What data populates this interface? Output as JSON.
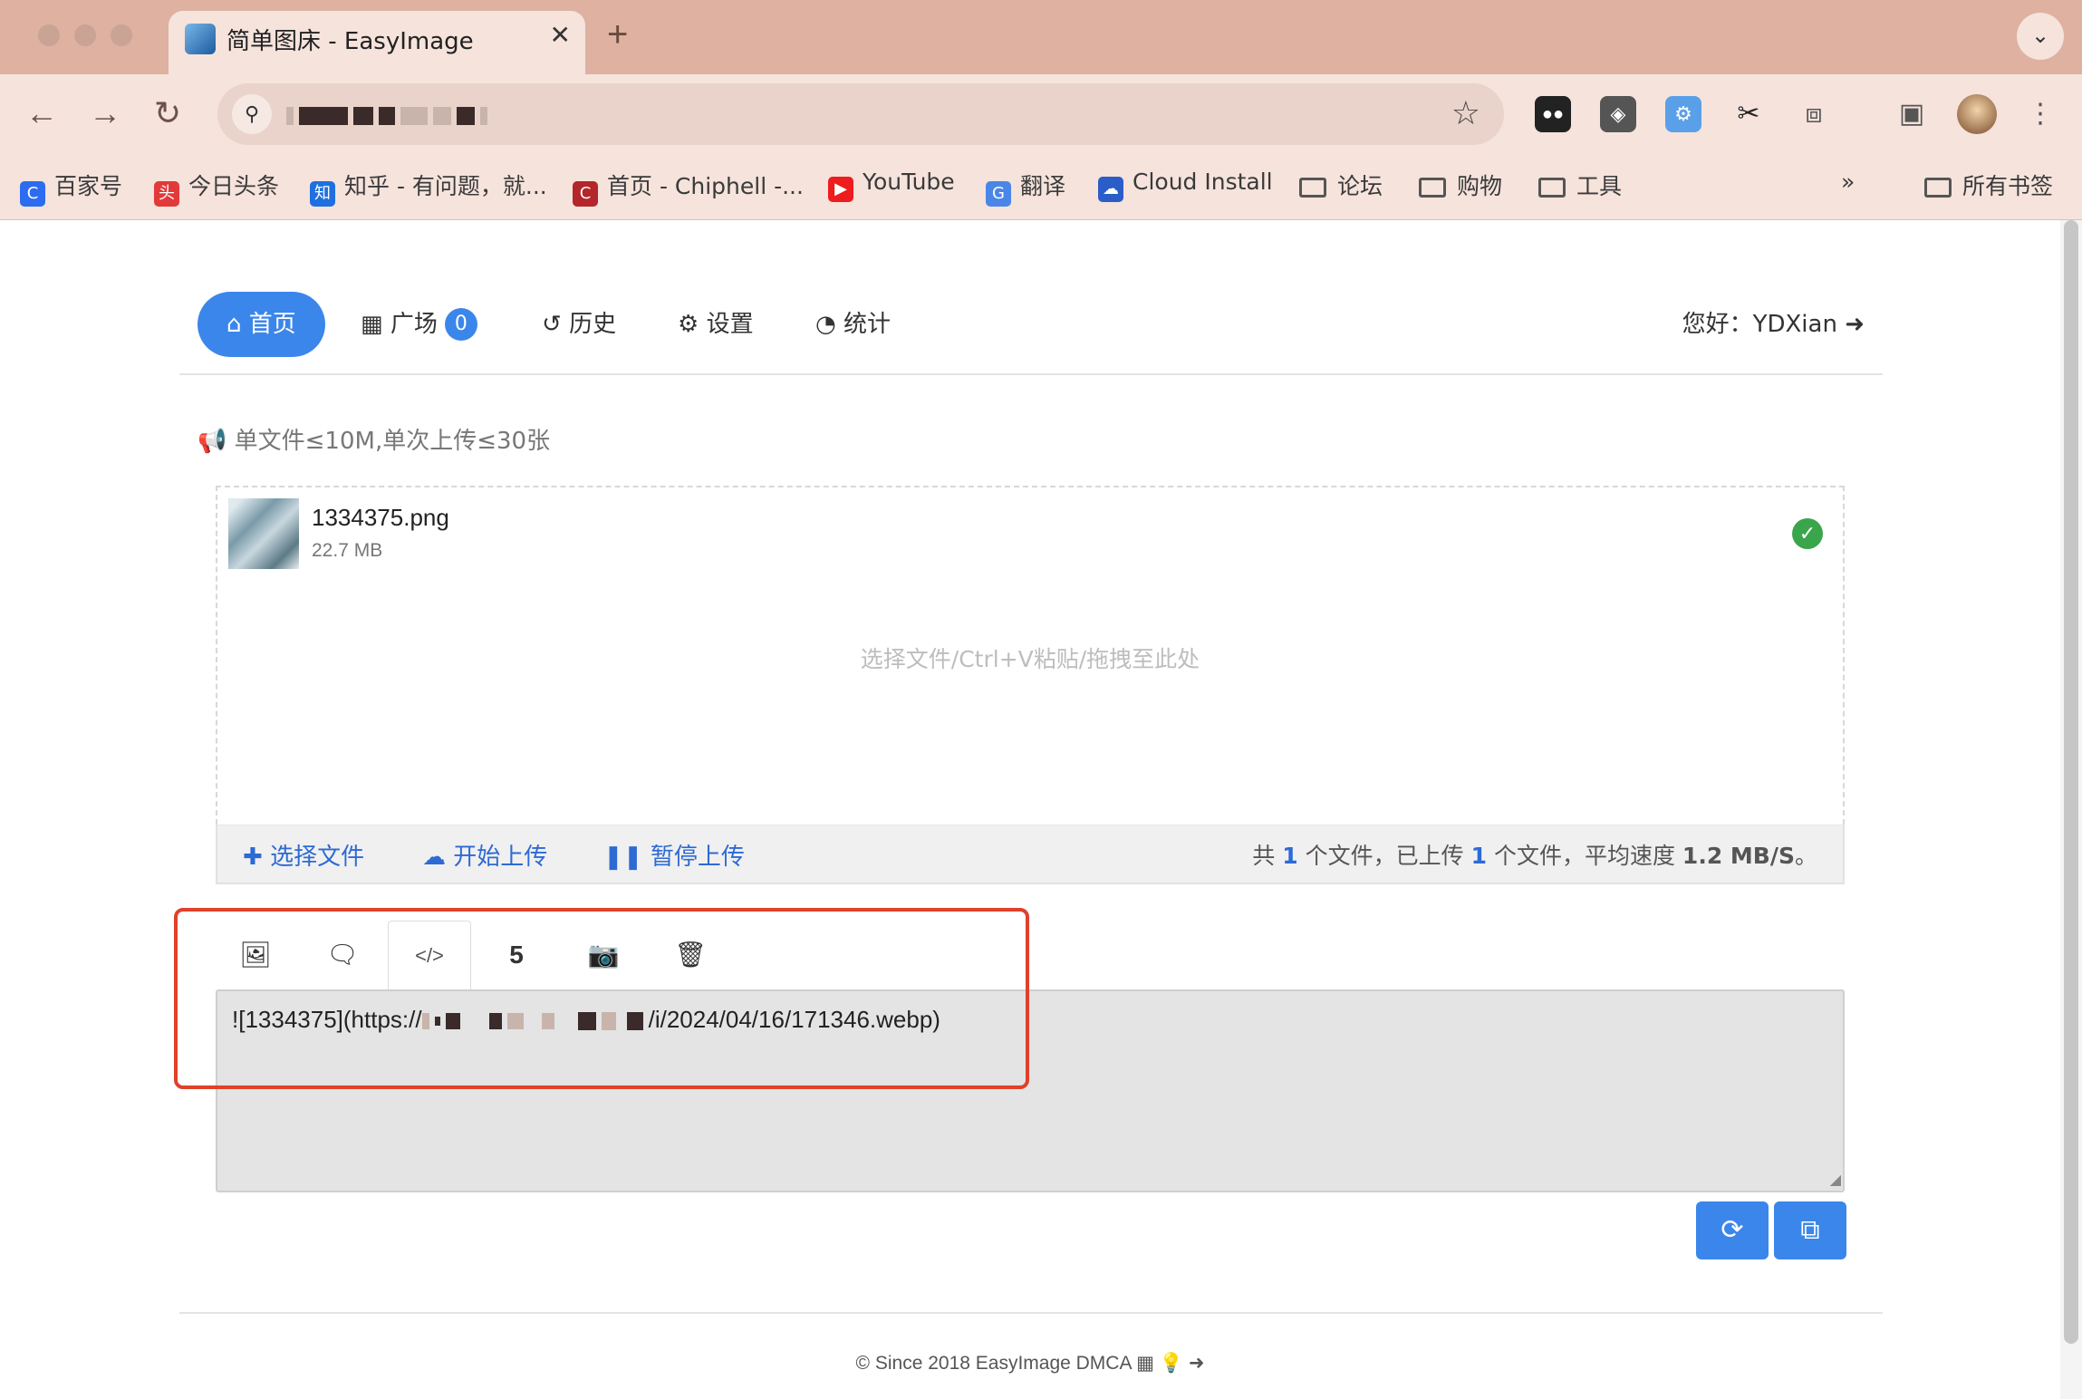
{
  "browser": {
    "tab_title": "简单图床 - EasyImage",
    "tab_close": "✕",
    "new_tab": "+",
    "tab_menu": "⌄",
    "back": "←",
    "forward": "→",
    "reload": "↻",
    "url_tune": "⚲",
    "url_fragment": "ツ",
    "url_star": "☆",
    "more": "⋮",
    "bookmarks": [
      {
        "label": "百家号",
        "icon": "baijiahao-icon",
        "color": "#2b6cf0",
        "glyph": "C"
      },
      {
        "label": "今日头条",
        "icon": "toutiao-icon",
        "color": "#e23a3a",
        "glyph": "头"
      },
      {
        "label": "知乎 - 有问题，就...",
        "icon": "zhihu-icon",
        "color": "#1f6fe0",
        "glyph": "知"
      },
      {
        "label": "首页 - Chiphell -...",
        "icon": "chiphell-icon",
        "color": "#b3262b",
        "glyph": "C"
      },
      {
        "label": "YouTube",
        "icon": "youtube-icon",
        "color": "#ee1c1c",
        "glyph": "▶"
      },
      {
        "label": "翻译",
        "icon": "translate-icon",
        "color": "#4a86e8",
        "glyph": "G"
      },
      {
        "label": "Cloud Install",
        "icon": "cloud-install-icon",
        "color": "#2a5dc8",
        "glyph": "☁"
      },
      {
        "label": "论坛",
        "icon": "folder-icon"
      },
      {
        "label": "购物",
        "icon": "folder-icon"
      },
      {
        "label": "工具",
        "icon": "folder-icon"
      }
    ],
    "bookmarks_overflow": "»",
    "all_bookmarks": "所有书签"
  },
  "nav": {
    "home": "首页",
    "square": "广场",
    "square_count": "0",
    "history": "历史",
    "settings": "设置",
    "stats": "统计",
    "greeting": "您好：YDXian"
  },
  "notice": "单文件≤10M,单次上传≤30张",
  "upload": {
    "file_name": "1334375.png",
    "file_size": "22.7 MB",
    "drop_hint": "选择文件/Ctrl+V粘贴/拖拽至此处",
    "select_label": "选择文件",
    "start_label": "开始上传",
    "pause_label": "暂停上传",
    "stats_prefix": "共",
    "total_files": "1",
    "stats_mid": "个文件，已上传",
    "uploaded_files": "1",
    "stats_speed_label": "个文件，平均速度",
    "speed": "1.2 MB/S",
    "stats_end": "。"
  },
  "formats": {
    "tabs": [
      {
        "name": "image-format-icon",
        "glyph": "🖼"
      },
      {
        "name": "bbcode-format-icon",
        "glyph": "🗨"
      },
      {
        "name": "markdown-format-icon",
        "glyph": "</>"
      },
      {
        "name": "html-format-icon",
        "glyph": "5"
      },
      {
        "name": "camera-icon",
        "glyph": "📷"
      },
      {
        "name": "trash-icon",
        "glyph": "🗑"
      }
    ],
    "active_index": 2,
    "code_prefix": "![1334375](https://",
    "code_suffix": "/i/2024/04/16/171346.webp)"
  },
  "actions": {
    "refresh": "⟳",
    "copy": "⧉"
  },
  "footer": {
    "text": "© Since 2018 EasyImage DMCA"
  },
  "colors": {
    "accent": "#3b86ea",
    "highlight": "#e0412b",
    "success": "#3aa54a"
  }
}
